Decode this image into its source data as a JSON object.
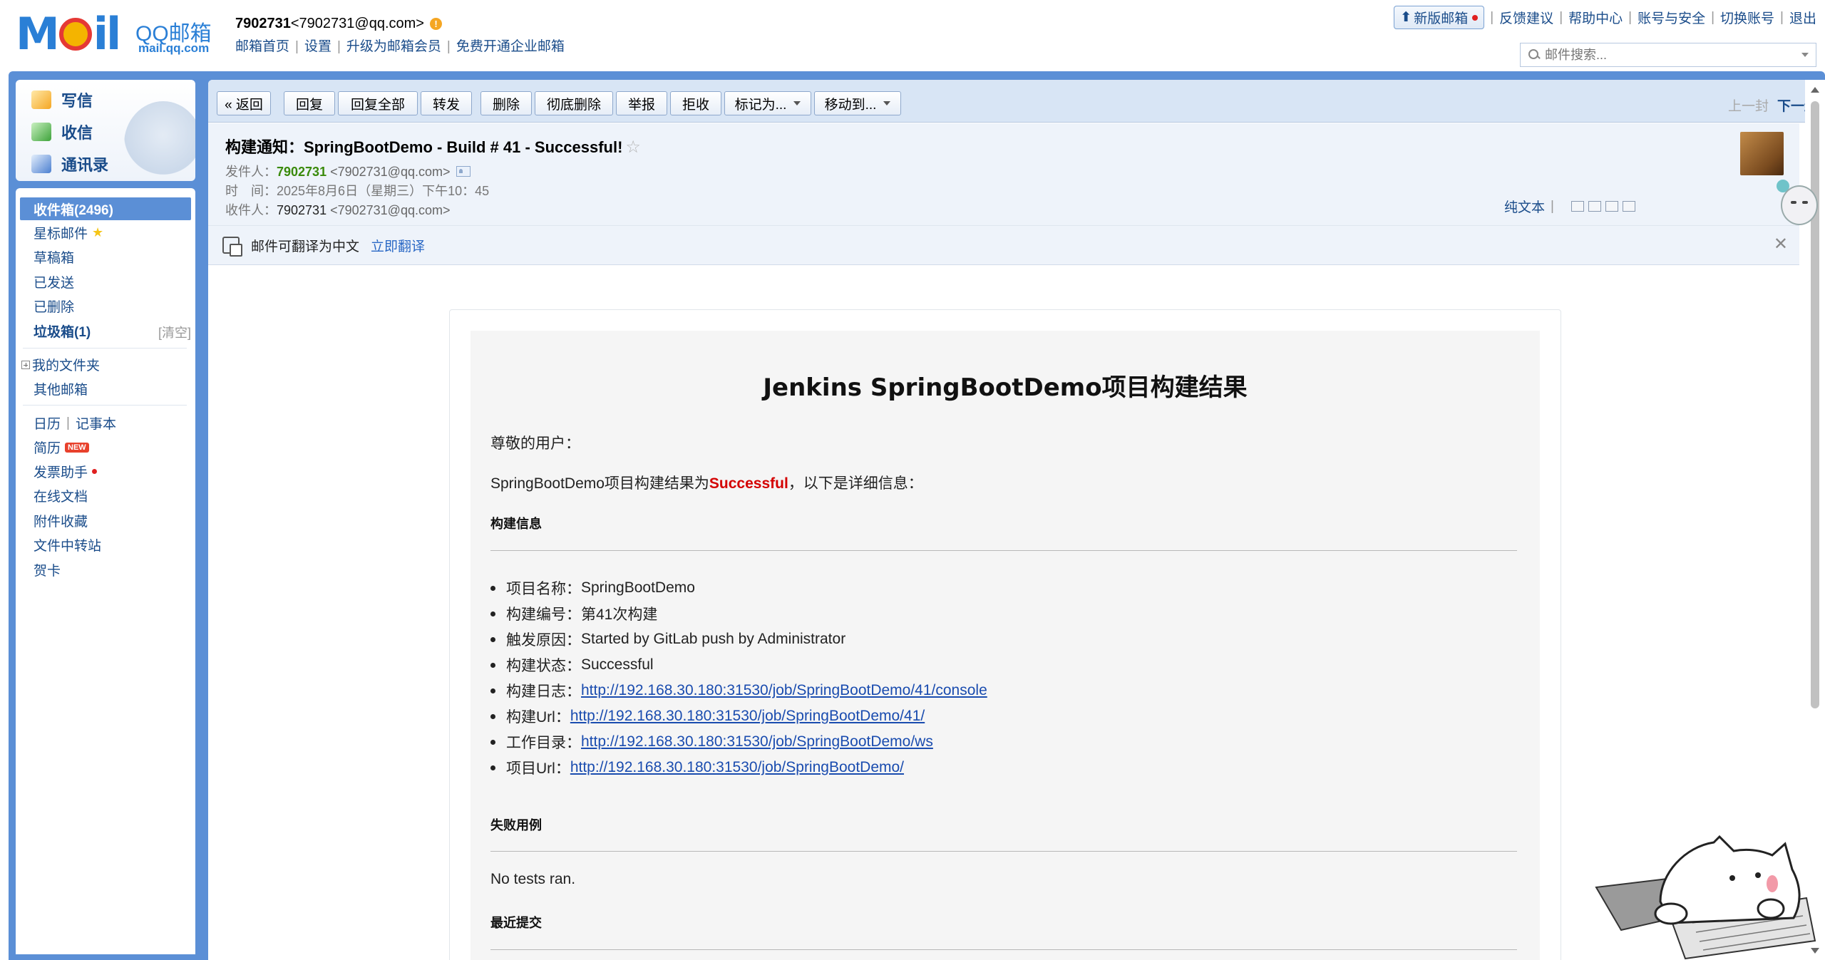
{
  "header": {
    "logo_text": "MOil",
    "logo_brand": "QQ邮箱",
    "logo_domain": "mail.qq.com",
    "user_id": "7902731",
    "user_email": "<7902731@qq.com>",
    "links": [
      "邮箱首页",
      "设置",
      "升级为邮箱会员",
      "免费开通企业邮箱"
    ],
    "new_version": "新版邮箱",
    "right_links": [
      "反馈建议",
      "帮助中心",
      "账号与安全",
      "切换账号",
      "退出"
    ],
    "search_placeholder": "邮件搜索...",
    "accent_color": "#5b8fd6"
  },
  "sidebar": {
    "quick": [
      "写信",
      "收信",
      "通讯录"
    ],
    "inbox": "收件箱(2496)",
    "starred": "星标邮件",
    "drafts": "草稿箱",
    "sent": "已发送",
    "deleted": "已删除",
    "junk": "垃圾箱(1)",
    "junk_clear": "[清空]",
    "my_folders": "我的文件夹",
    "other_mail": "其他邮箱",
    "calendar": "日历",
    "notes": "记事本",
    "resume": "简历",
    "new_badge": "NEW",
    "invoice": "发票助手",
    "docs": "在线文档",
    "attachments": "附件收藏",
    "file_transfer": "文件中转站",
    "cards": "贺卡"
  },
  "toolbar": {
    "back": "« 返回",
    "reply": "回复",
    "reply_all": "回复全部",
    "forward": "转发",
    "delete": "删除",
    "delete_forever": "彻底删除",
    "report": "举报",
    "reject": "拒收",
    "mark_as": "标记为...",
    "move_to": "移动到...",
    "prev": "上一封",
    "next": "下一封"
  },
  "mail": {
    "subject": "构建通知：SpringBootDemo - Build # 41 - Successful!",
    "from_label": "发件人：",
    "from_name": "7902731",
    "from_addr": "<7902731@qq.com>",
    "time_label": "时　间：",
    "time_value": "2025年8月6日（星期三）下午10：45",
    "to_label": "收件人：",
    "to_name": "7902731",
    "to_addr": "<7902731@qq.com>",
    "plain_text": "纯文本",
    "translate_tip": "邮件可翻译为中文",
    "translate_now": "立即翻译"
  },
  "content": {
    "title": "Jenkins SpringBootDemo项目构建结果",
    "greeting": "尊敬的用户：",
    "result_prefix": "SpringBootDemo项目构建结果为",
    "result_status": "Successful",
    "result_suffix": "，以下是详细信息：",
    "build_info_heading": "构建信息",
    "items": [
      {
        "label": "项目名称：",
        "value": "SpringBootDemo"
      },
      {
        "label": "构建编号：",
        "value": "第41次构建"
      },
      {
        "label": "触发原因：",
        "value": "Started by GitLab push by Administrator"
      },
      {
        "label": "构建状态：",
        "value": "Successful"
      },
      {
        "label": "构建日志：",
        "link": "http://192.168.30.180:31530/job/SpringBootDemo/41/console"
      },
      {
        "label": "构建Url：",
        "link": "http://192.168.30.180:31530/job/SpringBootDemo/41/"
      },
      {
        "label": "工作目录：",
        "link": "http://192.168.30.180:31530/job/SpringBootDemo/ws"
      },
      {
        "label": "项目Url：",
        "link": "http://192.168.30.180:31530/job/SpringBootDemo/"
      }
    ],
    "failed_heading": "失败用例",
    "failed_text": "No tests ran.",
    "recent_heading": "最近提交",
    "status_color": "#d40000",
    "link_color": "#1a4caf"
  }
}
